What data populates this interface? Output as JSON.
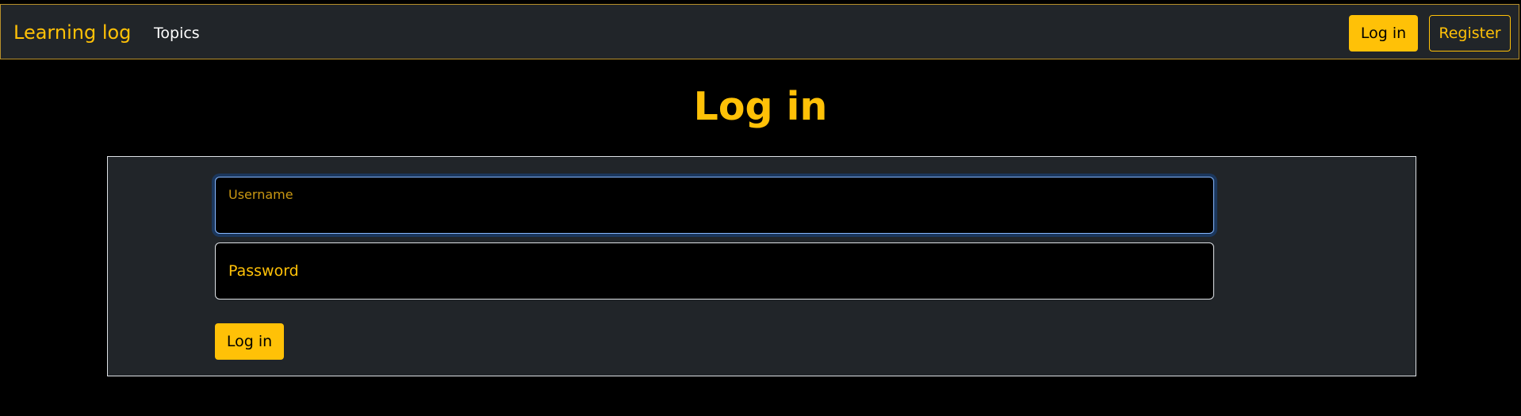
{
  "navbar": {
    "brand": "Learning log",
    "links": [
      {
        "label": "Topics"
      }
    ],
    "login_label": "Log in",
    "register_label": "Register"
  },
  "page": {
    "title": "Log in"
  },
  "form": {
    "username": {
      "label": "Username",
      "value": ""
    },
    "password": {
      "label": "Password",
      "value": ""
    },
    "submit_label": "Log in"
  },
  "colors": {
    "accent": "#ffc107",
    "navbar_bg": "#212529",
    "page_bg": "#000000",
    "focus_ring": "#86b7fe"
  }
}
